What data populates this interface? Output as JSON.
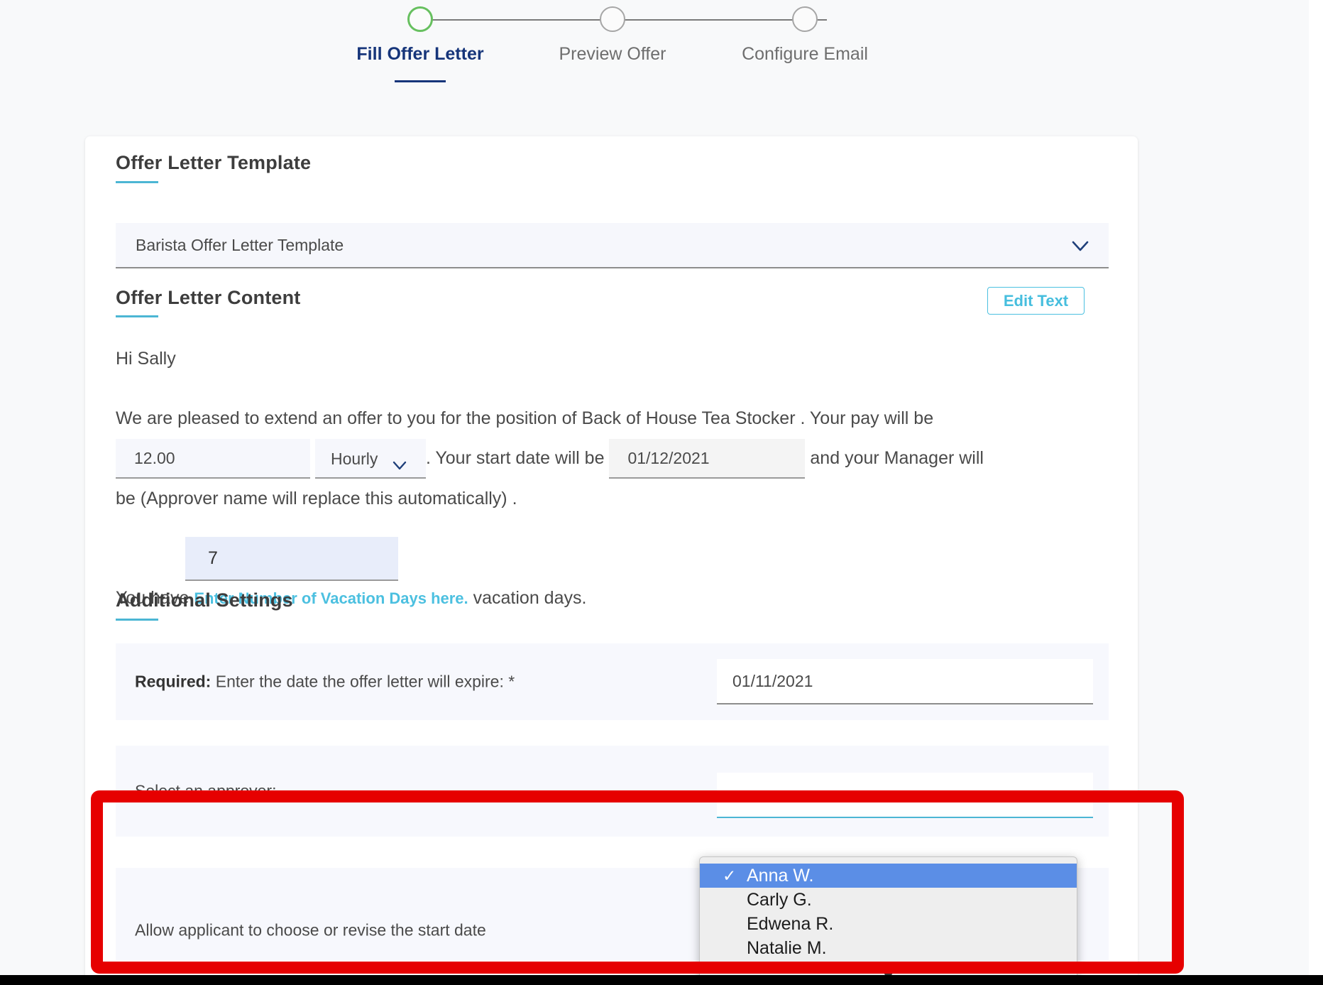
{
  "stepper": {
    "steps": [
      {
        "label": "Fill Offer Letter",
        "state": "active"
      },
      {
        "label": "Preview Offer",
        "state": "upcoming"
      },
      {
        "label": "Configure Email",
        "state": "upcoming"
      }
    ],
    "active_color": "#67c05f",
    "active_label_color": "#16357a",
    "inactive_color": "#a6a6a6"
  },
  "template_section": {
    "heading": "Offer Letter Template",
    "selected_template": "Barista Offer Letter Template",
    "chevron": "∨"
  },
  "content_section": {
    "heading": "Offer Letter Content",
    "edit_button": "Edit Text",
    "greeting": "Hi Sally",
    "body_part1": "We are pleased to extend an offer to you for the position of Back of House Tea Stocker . Your pay will be",
    "pay_amount": "12.00",
    "pay_unit": "Hourly",
    "pay_unit_chevron": "∨",
    "body_part2": ". Your start date will be",
    "start_date": "01/12/2021",
    "body_part3": "and your Manager will",
    "body_part4": "be (Approver name will replace this automatically) .",
    "vacation_days": "7",
    "vacation_prefix": "You have",
    "vacation_placeholder": "Enter Number of Vacation Days here.",
    "vacation_suffix": "vacation days."
  },
  "additional_settings": {
    "heading": "Additional Settings",
    "expire_label_bold": "Required:",
    "expire_label_rest": " Enter the date the offer letter will expire: *",
    "expire_date": "01/11/2021",
    "approver_label": "Select an approver:",
    "start_date_row_label": "Allow applicant to choose or revise the start date"
  },
  "approver_dropdown": {
    "options": [
      "Anna W.",
      "Carly G.",
      "Edwena R.",
      "Natalie M."
    ],
    "selected": "Anna W.",
    "check_glyph": "✓",
    "scroll_arrow": "▼",
    "highlight_color": "#5b8ee6"
  },
  "annotation": {
    "highlight_color": "#e60000"
  },
  "colors": {
    "accent_cyan": "#4cb6d4",
    "navy": "#16357a",
    "page_bg": "#f8f9fa",
    "field_bg": "#f6f7fc"
  }
}
